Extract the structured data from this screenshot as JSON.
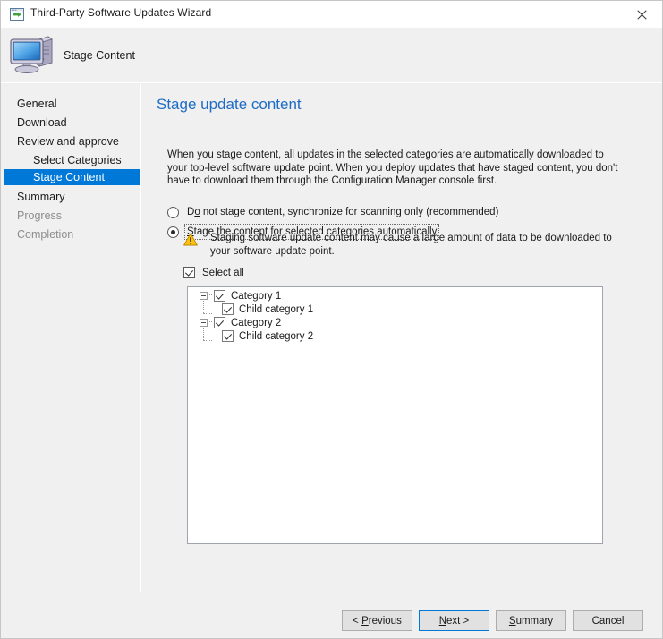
{
  "window": {
    "title": "Third-Party Software Updates Wizard",
    "title_icon": "wizard-window-icon",
    "close_icon": "close-icon",
    "header_icon": "computer-icon",
    "header_title": "Stage Content"
  },
  "sidebar": {
    "items": [
      {
        "label": "General",
        "level": 0,
        "state": "normal"
      },
      {
        "label": "Download",
        "level": 0,
        "state": "normal"
      },
      {
        "label": "Review and approve",
        "level": 0,
        "state": "normal"
      },
      {
        "label": "Select Categories",
        "level": 1,
        "state": "normal"
      },
      {
        "label": "Stage Content",
        "level": 1,
        "state": "selected"
      },
      {
        "label": "Summary",
        "level": 0,
        "state": "normal"
      },
      {
        "label": "Progress",
        "level": 0,
        "state": "disabled"
      },
      {
        "label": "Completion",
        "level": 0,
        "state": "disabled"
      }
    ],
    "selected_color": "#0078d7",
    "disabled_color": "#8d8d8d"
  },
  "main": {
    "heading": "Stage update content",
    "heading_color": "#1f6cc4",
    "intro": "When you stage content, all updates in the selected categories are automatically downloaded to your top-level software update point. When you deploy updates that have staged content, you don't have to download them through the Configuration Manager console first.",
    "options": [
      {
        "label_before": "D",
        "label_accel": "o",
        "label_after": " not stage content, synchronize for scanning only (recommended)",
        "full_label": "Do not stage content, synchronize for scanning only (recommended)",
        "selected": false,
        "focused": false
      },
      {
        "label_before": "",
        "label_accel": "S",
        "label_after": "tage the content for selected categories automatically",
        "full_label": "Stage the content for selected categories automatically",
        "selected": true,
        "focused": true
      }
    ],
    "warning": {
      "icon": "warning-triangle-icon",
      "text": "Staging software update content may cause a large amount of data to be downloaded to your software update point.",
      "color": "#ffc20e"
    },
    "select_all": {
      "label_before": "S",
      "label_accel": "e",
      "label_after": "lect all",
      "full_label": "Select all",
      "checked": true
    },
    "tree": [
      {
        "label": "Category 1",
        "level": 0,
        "checked": true,
        "expanded": true
      },
      {
        "label": "Child category 1",
        "level": 1,
        "checked": true,
        "expanded": null
      },
      {
        "label": "Category 2",
        "level": 0,
        "checked": true,
        "expanded": true
      },
      {
        "label": "Child category 2",
        "level": 1,
        "checked": true,
        "expanded": null
      }
    ]
  },
  "footer": {
    "buttons": [
      {
        "before": "< ",
        "accel": "P",
        "after": "revious",
        "full": "< Previous",
        "default": false
      },
      {
        "before": "",
        "accel": "N",
        "after": "ext >",
        "full": "Next >",
        "default": true
      },
      {
        "before": "",
        "accel": "S",
        "after": "ummary",
        "full": "Summary",
        "default": false
      },
      {
        "before": "Cancel",
        "accel": "",
        "after": "",
        "full": "Cancel",
        "default": false
      }
    ],
    "default_border_color": "#0078d7"
  }
}
